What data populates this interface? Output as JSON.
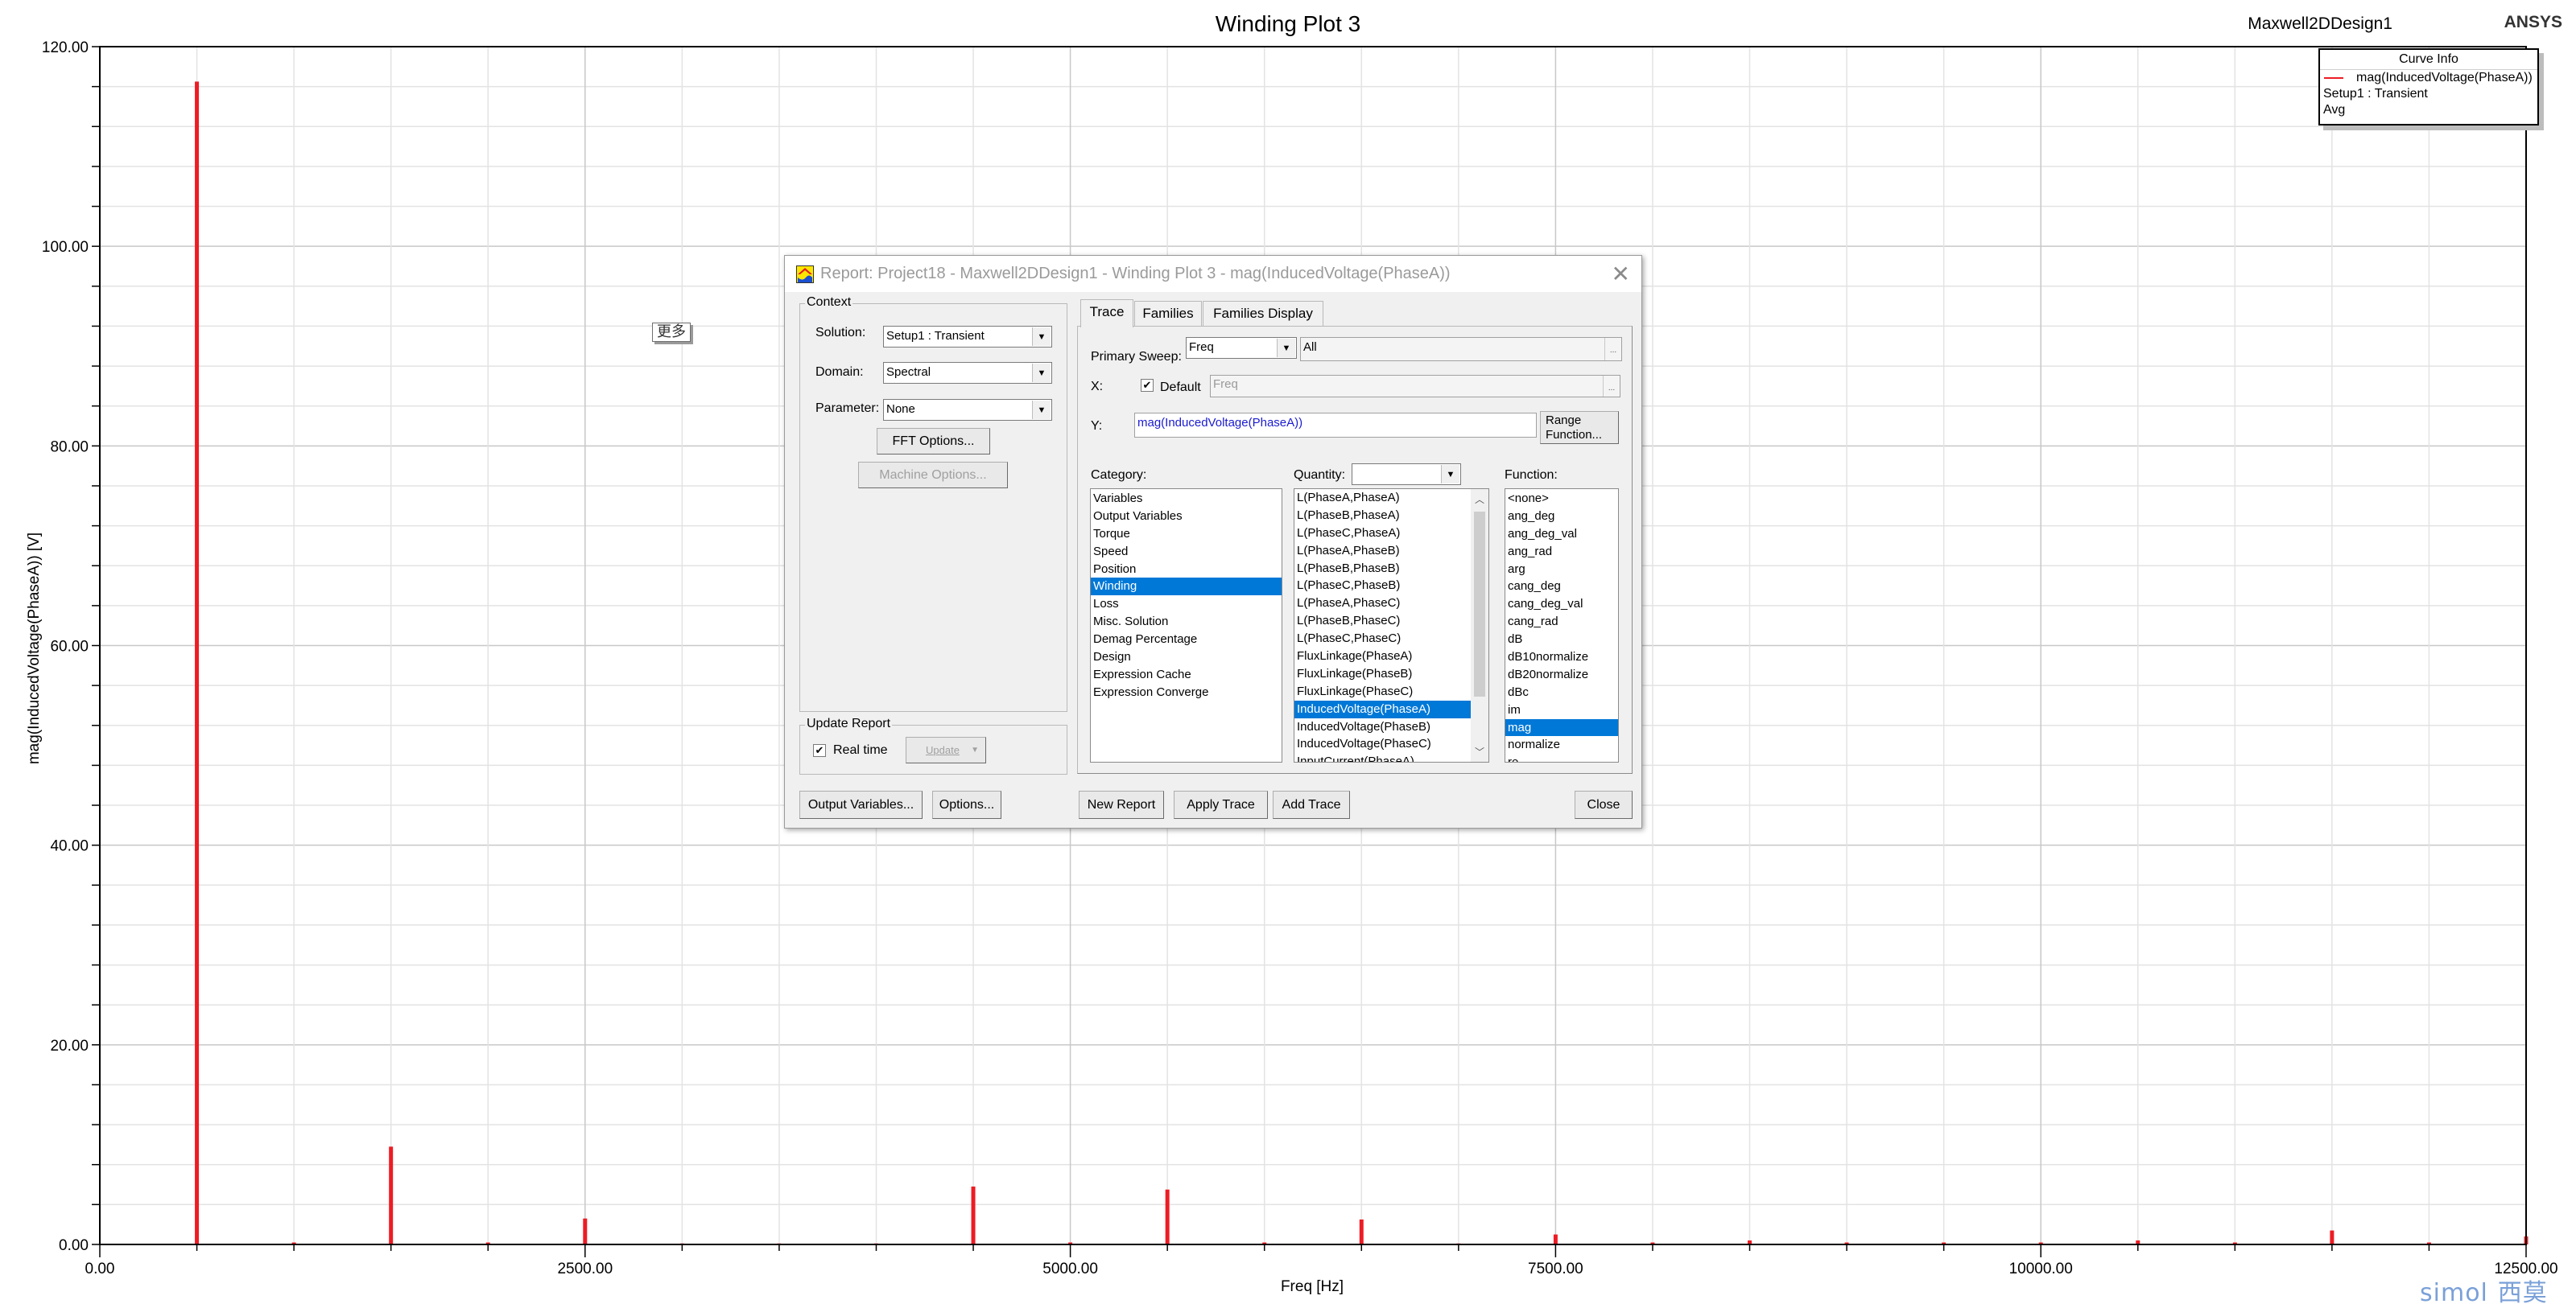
{
  "plot": {
    "title": "Winding Plot 3",
    "design_name": "Maxwell2DDesign1",
    "brand": "ANSYS",
    "more_button": "更多",
    "watermark_latin": "simol",
    "watermark_cjk": "西莫"
  },
  "legend": {
    "header": "Curve Info",
    "trace": "mag(InducedVoltage(PhaseA))",
    "solution": "Setup1 : Transient",
    "stat": "Avg",
    "color": "#ed1c24"
  },
  "chart_data": {
    "type": "bar",
    "title": "Winding Plot 3",
    "xlabel": "Freq [Hz]",
    "ylabel": "mag(InducedVoltage(PhaseA)) [V]",
    "xlim": [
      0,
      12500
    ],
    "ylim": [
      0,
      120
    ],
    "x_ticks": [
      0,
      2500,
      5000,
      7500,
      10000,
      12500
    ],
    "x_tick_labels": [
      "0.00",
      "2500.00",
      "5000.00",
      "7500.00",
      "10000.00",
      "12500.00"
    ],
    "x_minor_step": 500,
    "y_ticks": [
      0,
      20,
      40,
      60,
      80,
      100,
      120
    ],
    "y_tick_labels": [
      "0.00",
      "20.00",
      "40.00",
      "60.00",
      "80.00",
      "100.00",
      "120.00"
    ],
    "y_minor_step": 4,
    "grid": true,
    "legend_position": "top-right",
    "series": [
      {
        "name": "mag(InducedVoltage(PhaseA))",
        "color": "#ed1c24",
        "x": [
          500,
          1000,
          1500,
          2000,
          2500,
          3000,
          3500,
          4000,
          4500,
          5000,
          5500,
          6000,
          6500,
          7000,
          7500,
          8000,
          8500,
          9000,
          9500,
          10000,
          10500,
          11000,
          11500,
          12000,
          12500
        ],
        "values": [
          116.5,
          0.2,
          9.8,
          0.2,
          2.6,
          0.1,
          0.1,
          0.1,
          5.8,
          0.2,
          5.5,
          0.2,
          2.5,
          0.1,
          1.0,
          0.2,
          0.4,
          0.2,
          0.2,
          0.2,
          0.4,
          0.2,
          1.4,
          0.2,
          0.8
        ]
      }
    ]
  },
  "dialog": {
    "title": "Report: Project18 - Maxwell2DDesign1 - Winding Plot 3 - mag(InducedVoltage(PhaseA))",
    "context": {
      "label": "Context",
      "solution_label": "Solution:",
      "solution_value": "Setup1 : Transient",
      "domain_label": "Domain:",
      "domain_value": "Spectral",
      "parameter_label": "Parameter:",
      "parameter_value": "None",
      "fft_options": "FFT Options...",
      "machine_options": "Machine Options..."
    },
    "update_report": {
      "label": "Update Report",
      "real_time_label": "Real time",
      "real_time_checked": true,
      "update_button": "Update"
    },
    "tabs": [
      "Trace",
      "Families",
      "Families Display"
    ],
    "active_tab": "Trace",
    "trace": {
      "primary_sweep_label": "Primary Sweep:",
      "primary_sweep_value": "Freq",
      "sweep_range": "All",
      "x_label": "X:",
      "x_default_label": "Default",
      "x_default_checked": true,
      "x_value": "Freq",
      "y_label": "Y:",
      "y_value": "mag(InducedVoltage(PhaseA))",
      "range_function_line1": "Range",
      "range_function_line2": "Function...",
      "category_label": "Category:",
      "quantity_label": "Quantity:",
      "quantity_filter": "",
      "function_label": "Function:",
      "categories": [
        "Variables",
        "Output Variables",
        "Torque",
        "Speed",
        "Position",
        "Winding",
        "Loss",
        "Misc. Solution",
        "Demag Percentage",
        "Design",
        "Expression Cache",
        "Expression Converge"
      ],
      "selected_category": "Winding",
      "quantities": [
        "L(PhaseA,PhaseA)",
        "L(PhaseB,PhaseA)",
        "L(PhaseC,PhaseA)",
        "L(PhaseA,PhaseB)",
        "L(PhaseB,PhaseB)",
        "L(PhaseC,PhaseB)",
        "L(PhaseA,PhaseC)",
        "L(PhaseB,PhaseC)",
        "L(PhaseC,PhaseC)",
        "FluxLinkage(PhaseA)",
        "FluxLinkage(PhaseB)",
        "FluxLinkage(PhaseC)",
        "InducedVoltage(PhaseA)",
        "InducedVoltage(PhaseB)",
        "InducedVoltage(PhaseC)",
        "InputCurrent(PhaseA)"
      ],
      "selected_quantity": "InducedVoltage(PhaseA)",
      "functions": [
        "<none>",
        "ang_deg",
        "ang_deg_val",
        "ang_rad",
        "arg",
        "cang_deg",
        "cang_deg_val",
        "cang_rad",
        "dB",
        "dB10normalize",
        "dB20normalize",
        "dBc",
        "im",
        "mag",
        "normalize",
        "re"
      ],
      "selected_function": "mag"
    },
    "buttons": {
      "output_variables": "Output Variables...",
      "options": "Options...",
      "new_report": "New Report",
      "apply_trace": "Apply Trace",
      "add_trace": "Add Trace",
      "close": "Close"
    }
  }
}
